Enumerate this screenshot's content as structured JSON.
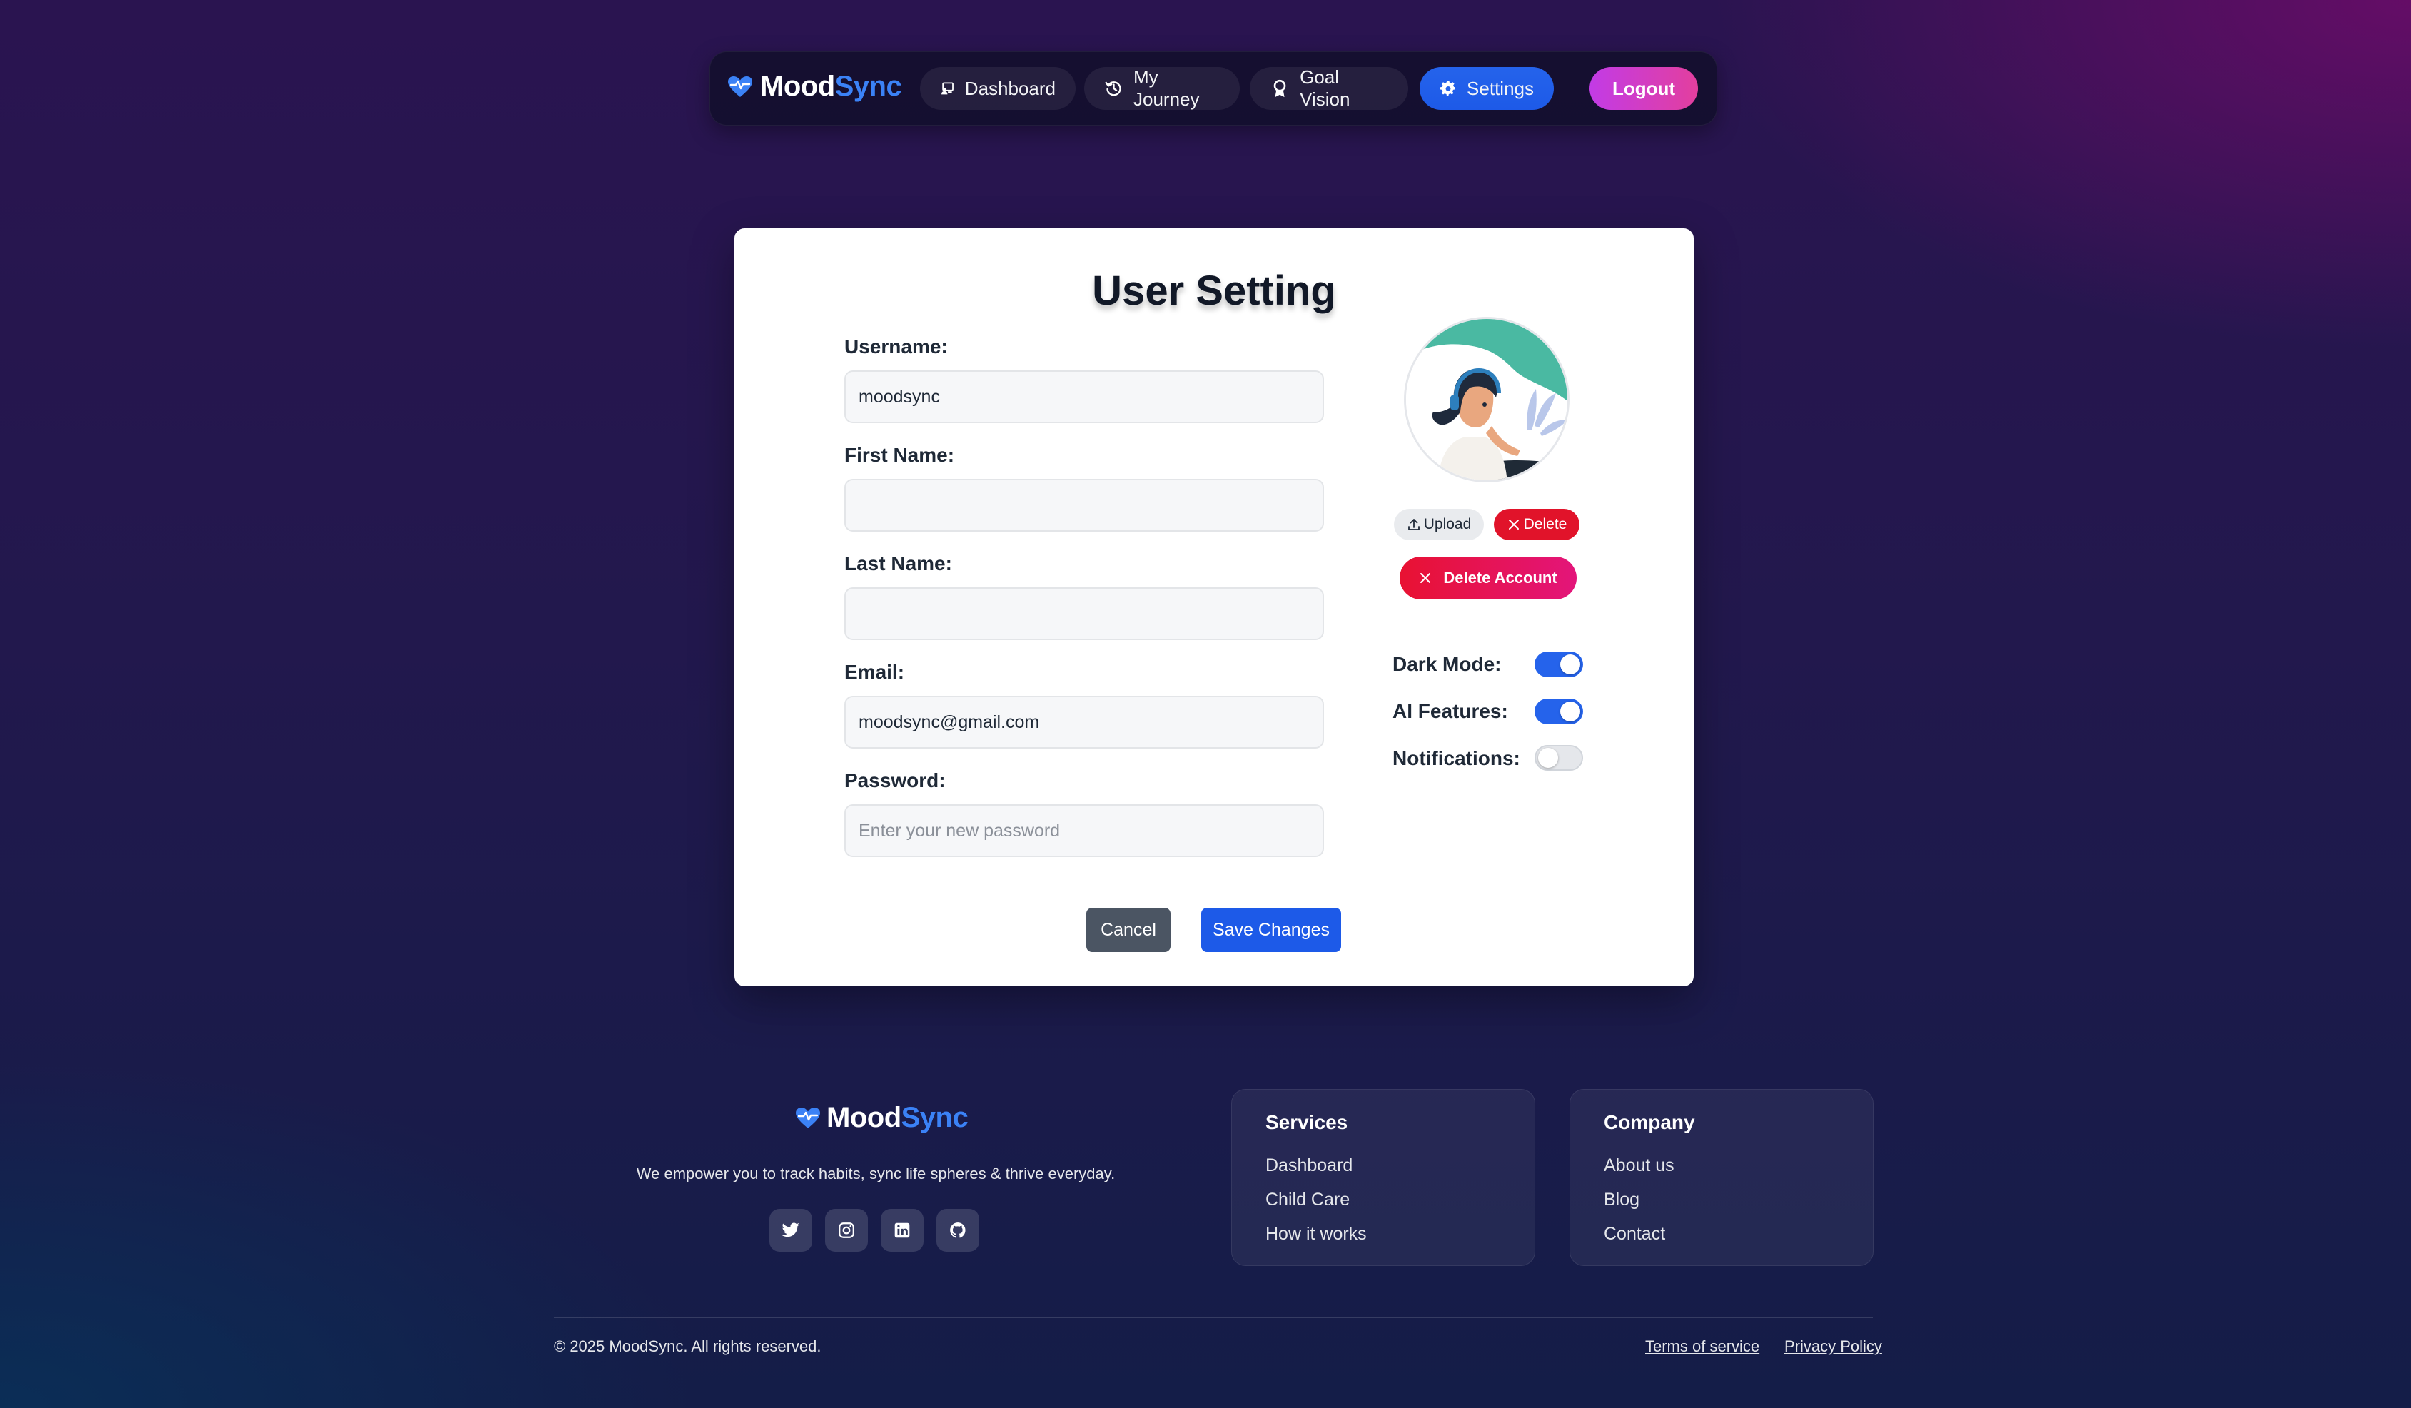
{
  "app": {
    "brand_part1": "Mood",
    "brand_part2": "Sync",
    "brand_color": "#3b82f6"
  },
  "nav": {
    "items": [
      {
        "label": "Dashboard",
        "icon": "dashboard-icon"
      },
      {
        "label": "My Journey",
        "icon": "history-icon"
      },
      {
        "label": "Goal Vision",
        "icon": "award-icon"
      },
      {
        "label": "Settings",
        "icon": "gear-icon",
        "active": true
      }
    ],
    "logout_label": "Logout"
  },
  "settings": {
    "title": "User Setting",
    "fields": {
      "username": {
        "label": "Username:",
        "value": "moodsync",
        "placeholder": ""
      },
      "first_name": {
        "label": "First Name:",
        "value": "",
        "placeholder": ""
      },
      "last_name": {
        "label": "Last Name:",
        "value": "",
        "placeholder": ""
      },
      "email": {
        "label": "Email:",
        "value": "moodsync@gmail.com",
        "placeholder": ""
      },
      "password": {
        "label": "Password:",
        "value": "",
        "placeholder": "Enter your new password"
      }
    },
    "upload_label": "Upload",
    "delete_label": "Delete",
    "delete_account_label": "Delete Account",
    "toggles": [
      {
        "label": "Dark Mode:",
        "on": true
      },
      {
        "label": "AI Features:",
        "on": true
      },
      {
        "label": "Notifications:",
        "on": false
      }
    ],
    "cancel_label": "Cancel",
    "save_label": "Save Changes"
  },
  "footer": {
    "tagline": "We empower you to track habits, sync life spheres & thrive everyday.",
    "social": [
      "twitter-icon",
      "instagram-icon",
      "linkedin-icon",
      "github-icon"
    ],
    "services": {
      "title": "Services",
      "links": [
        "Dashboard",
        "Child Care",
        "How it works"
      ]
    },
    "company": {
      "title": "Company",
      "links": [
        "About us",
        "Blog",
        "Contact"
      ]
    },
    "copyright": "© 2025 MoodSync. All rights reserved.",
    "terms_label": "Terms of service",
    "privacy_label": "Privacy Policy"
  }
}
